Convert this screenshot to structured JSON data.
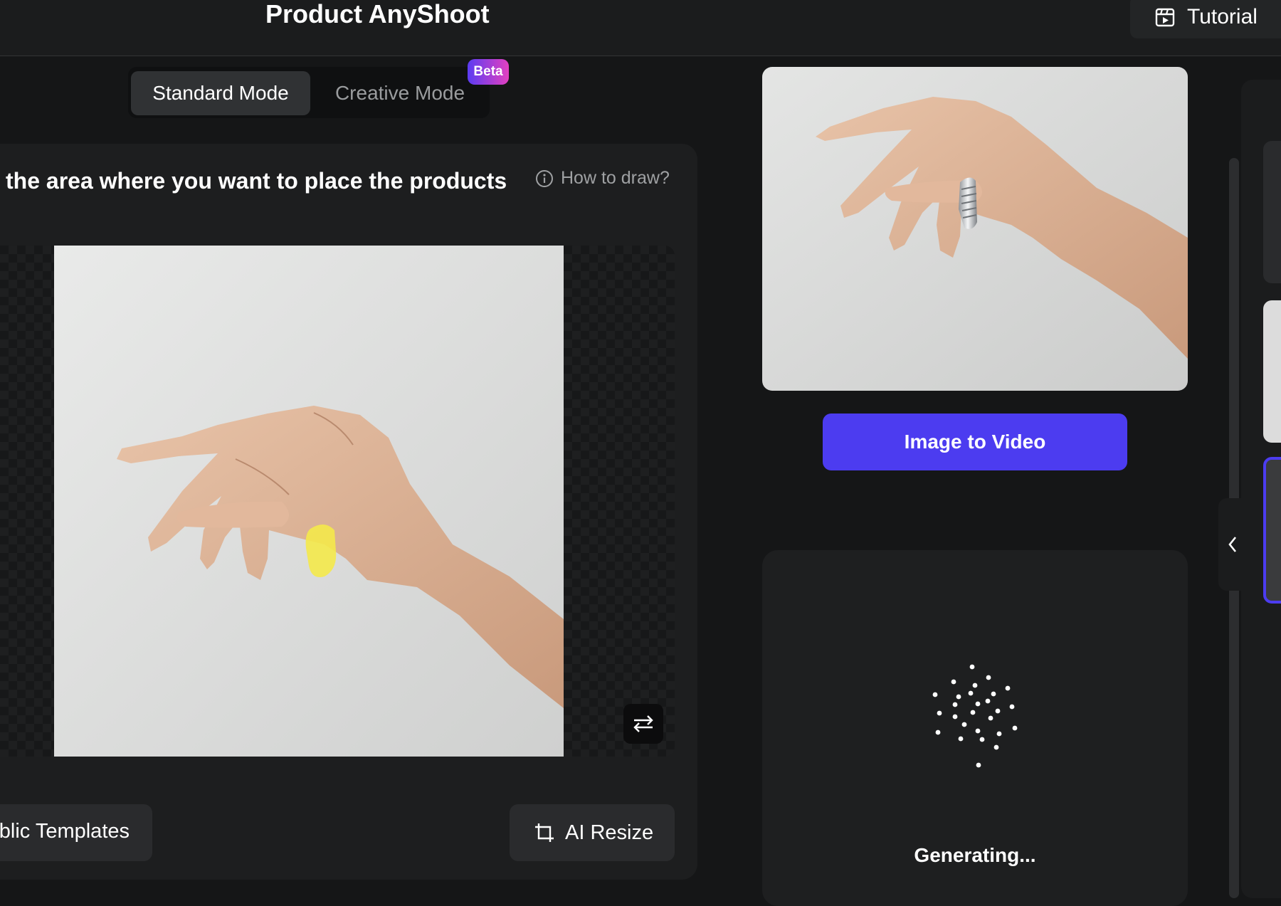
{
  "header": {
    "title": "Product AnyShoot",
    "tutorial_label": "Tutorial",
    "tutorial_icon": "video-icon"
  },
  "mode": {
    "standard_label": "Standard Mode",
    "creative_label": "Creative Mode",
    "badge": "Beta",
    "selected": "Standard Mode"
  },
  "editor": {
    "instruction": "the area where you want to place the products",
    "help_label": "How to draw?",
    "help_icon": "info-icon",
    "swap_icon": "swap-icon",
    "mask_color": "#f4e94a"
  },
  "actions": {
    "templates_label": "blic Templates",
    "resize_label": "AI Resize",
    "resize_icon": "crop-icon"
  },
  "result": {
    "video_button_label": "Image to Video",
    "generating_text": "Generating...",
    "spinner_icon": "loading-dots-icon"
  },
  "sidebar": {
    "collapse_icon": "chevron-left-icon"
  },
  "colors": {
    "accent": "#4c3cf0",
    "background": "#151617",
    "panel": "#1d1e1f",
    "badge_gradient_start": "#5b3cf2",
    "badge_gradient_end": "#e340c0"
  }
}
